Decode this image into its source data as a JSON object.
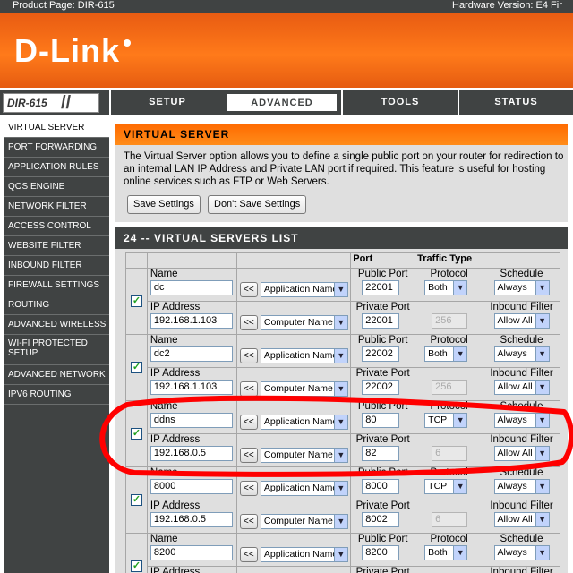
{
  "topbar": {
    "product": "Product Page: DIR-615",
    "hardware": "Hardware Version: E4   Fir"
  },
  "brand": {
    "logo": "D-Link",
    "model": "DIR-615"
  },
  "nav": {
    "tabs": [
      "SETUP",
      "ADVANCED",
      "TOOLS",
      "STATUS"
    ],
    "active": "ADVANCED"
  },
  "sidebar": {
    "items": [
      "VIRTUAL SERVER",
      "PORT FORWARDING",
      "APPLICATION RULES",
      "QOS ENGINE",
      "NETWORK FILTER",
      "ACCESS CONTROL",
      "WEBSITE FILTER",
      "INBOUND FILTER",
      "FIREWALL SETTINGS",
      "ROUTING",
      "ADVANCED WIRELESS",
      "WI-FI PROTECTED SETUP",
      "ADVANCED NETWORK",
      "IPV6 ROUTING"
    ],
    "active": "VIRTUAL SERVER"
  },
  "virtual_server": {
    "title": "VIRTUAL SERVER",
    "description": "The Virtual Server option allows you to define a single public port on your router for redirection to an internal LAN IP Address and Private LAN port if required. This feature is useful for hosting online services such as FTP or Web Servers.",
    "save_label": "Save Settings",
    "dont_save_label": "Don't Save Settings"
  },
  "list": {
    "title": "24 -- VIRTUAL SERVERS LIST",
    "headers": {
      "port": "Port",
      "traffic_type": "Traffic Type"
    },
    "labels": {
      "name": "Name",
      "ip": "IP Address",
      "public_port": "Public Port",
      "private_port": "Private Port",
      "protocol": "Protocol",
      "schedule": "Schedule",
      "inbound_filter": "Inbound Filter",
      "app_select": "Application Name",
      "computer_select": "Computer Name",
      "arrow_btn": "<<"
    },
    "rows": [
      {
        "checked": true,
        "name": "dc",
        "ip": "192.168.1.103",
        "public_port": "22001",
        "private_port": "22001",
        "protocol": "Both",
        "proto_num": "256",
        "schedule": "Always",
        "inbound": "Allow All"
      },
      {
        "checked": true,
        "name": "dc2",
        "ip": "192.168.1.103",
        "public_port": "22002",
        "private_port": "22002",
        "protocol": "Both",
        "proto_num": "256",
        "schedule": "Always",
        "inbound": "Allow All"
      },
      {
        "checked": true,
        "name": "ddns",
        "ip": "192.168.0.5",
        "public_port": "80",
        "private_port": "82",
        "protocol": "TCP",
        "proto_num": "6",
        "schedule": "Always",
        "inbound": "Allow All"
      },
      {
        "checked": true,
        "name": "8000",
        "ip": "192.168.0.5",
        "public_port": "8000",
        "private_port": "8002",
        "protocol": "TCP",
        "proto_num": "6",
        "schedule": "Always",
        "inbound": "Allow All"
      },
      {
        "checked": true,
        "name": "8200",
        "ip": "",
        "public_port": "8200",
        "private_port": "",
        "protocol": "Both",
        "proto_num": "",
        "schedule": "Always",
        "inbound": ""
      }
    ]
  },
  "colors": {
    "brand_orange": "#ff6a00",
    "nav_dark": "#404343",
    "annotation_red": "#ff0000"
  }
}
